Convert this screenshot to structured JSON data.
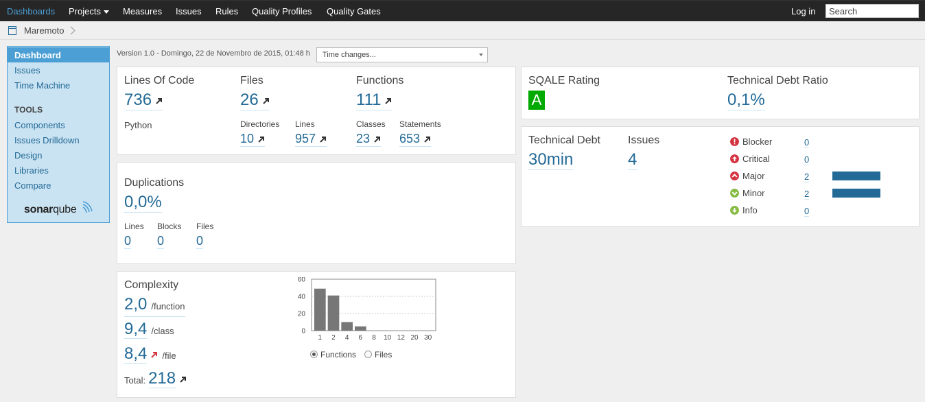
{
  "nav": {
    "items": [
      "Dashboards",
      "Projects",
      "Measures",
      "Issues",
      "Rules",
      "Quality Profiles",
      "Quality Gates"
    ],
    "login": "Log in",
    "search_placeholder": "Search"
  },
  "breadcrumb": {
    "project": "Maremoto"
  },
  "sidebar": {
    "items": [
      "Dashboard",
      "Issues",
      "Time Machine"
    ],
    "tools_heading": "TOOLS",
    "tools": [
      "Components",
      "Issues Drilldown",
      "Design",
      "Libraries",
      "Compare"
    ],
    "logo_text_bold": "sonar",
    "logo_text_normal": "qube"
  },
  "version_text": "Version 1.0 - Domingo, 22 de Novembro de 2015, 01:48 h",
  "time_changes": "Time changes...",
  "size": {
    "loc_title": "Lines Of Code",
    "loc": "736",
    "language": "Python",
    "files_title": "Files",
    "files": "26",
    "functions_title": "Functions",
    "functions": "111",
    "directories_label": "Directories",
    "directories": "10",
    "lines_label": "Lines",
    "lines": "957",
    "classes_label": "Classes",
    "classes": "23",
    "statements_label": "Statements",
    "statements": "653"
  },
  "duplications": {
    "title": "Duplications",
    "value": "0,0%",
    "lines_label": "Lines",
    "lines": "0",
    "blocks_label": "Blocks",
    "blocks": "0",
    "files_label": "Files",
    "files": "0"
  },
  "complexity": {
    "title": "Complexity",
    "per_function": "2,0",
    "per_function_unit": "/function",
    "per_class": "9,4",
    "per_class_unit": "/class",
    "per_file": "8,4",
    "per_file_unit": "/file",
    "total_label": "Total:",
    "total": "218",
    "radio_functions": "Functions",
    "radio_files": "Files"
  },
  "sqale": {
    "rating_title": "SQALE Rating",
    "rating": "A",
    "ratio_title": "Technical Debt Ratio",
    "ratio": "0,1%"
  },
  "debt": {
    "debt_title": "Technical Debt",
    "debt": "30min",
    "issues_title": "Issues",
    "issues": "4",
    "severities": [
      {
        "label": "Blocker",
        "count": "0",
        "color": "#d4333f",
        "bar_fraction": 0
      },
      {
        "label": "Critical",
        "count": "0",
        "color": "#d4333f",
        "bar_fraction": 0
      },
      {
        "label": "Major",
        "count": "2",
        "color": "#d4333f",
        "bar_fraction": 1
      },
      {
        "label": "Minor",
        "count": "2",
        "color": "#85bb43",
        "bar_fraction": 1
      },
      {
        "label": "Info",
        "count": "0",
        "color": "#85bb43",
        "bar_fraction": 0
      }
    ]
  },
  "chart_data": {
    "type": "bar",
    "categories": [
      "1",
      "2",
      "4",
      "6",
      "8",
      "10",
      "12",
      "20",
      "30"
    ],
    "values": [
      49,
      41,
      10,
      5,
      0,
      0,
      0,
      0,
      0
    ],
    "yticks": [
      "0",
      "20",
      "40",
      "60"
    ],
    "ylim": [
      0,
      60
    ],
    "grid": true,
    "title": "",
    "xlabel": "",
    "ylabel": ""
  },
  "colors": {
    "accent": "#4b9fd5",
    "link": "#236a97",
    "bar": "#777777",
    "rating_green": "#00aa00"
  }
}
